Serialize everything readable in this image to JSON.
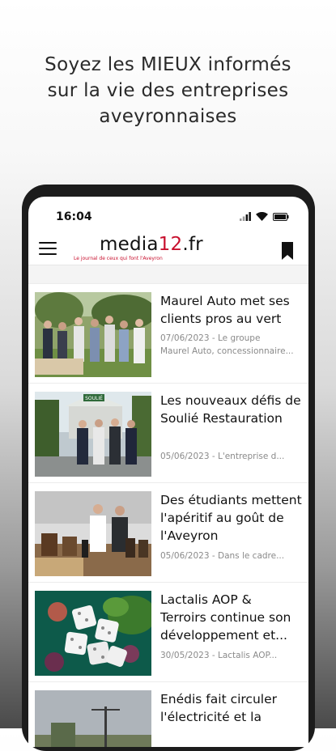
{
  "promo": {
    "line1": "Soyez les MIEUX informés",
    "line2": "sur la vie des entreprises",
    "line3": "aveyronnaises"
  },
  "status": {
    "time": "16:04"
  },
  "appbar": {
    "logo_prefix": "media",
    "logo_number": "12",
    "logo_suffix": ".fr",
    "tagline": "Le journal de ceux qui font l'Aveyron"
  },
  "articles": [
    {
      "title": "Maurel Auto met ses clients pros au vert",
      "meta_line1": "07/06/2023 - Le groupe",
      "meta_line2": "Maurel Auto, concessionnaire..."
    },
    {
      "title": "Les nouveaux défis de Soulié Restauration",
      "meta_line1": "05/06/2023 - L'entreprise d...",
      "sign": "SOULIÉ"
    },
    {
      "title": "Des étudiants mettent l'apéritif au goût de l'Aveyron",
      "meta_line1": "05/06/2023 - Dans le cadre..."
    },
    {
      "title_l1": "Lactalis AOP &",
      "title_l2": "Terroirs continue son",
      "title_l3": "développement et...",
      "meta_line1": "30/05/2023 - Lactalis AOP..."
    },
    {
      "title_l1": "Enédis fait circuler",
      "title_l2": "l'électricité et la"
    }
  ],
  "colors": {
    "brand_red": "#c8102e",
    "text": "#111111",
    "meta": "#8a8a8a"
  }
}
